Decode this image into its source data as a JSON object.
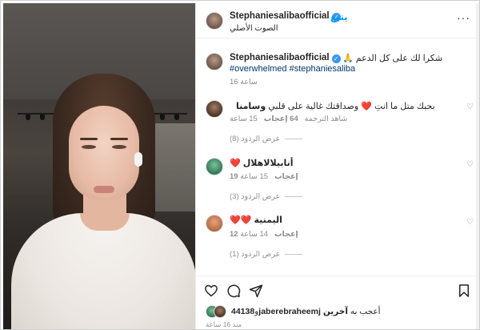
{
  "header": {
    "username": "Stephaniesaliba",
    "username_suffix": "official",
    "follow_label": "يتبع",
    "audio_label": "الصوت الأصلي"
  },
  "caption": {
    "username": "Stephaniesalibaofficial",
    "text": "🙏 شكرا لك على كل الدعم",
    "hashtags": "#overwhelmed #stephaniesaliba",
    "time": "16 ساعة"
  },
  "comments": [
    {
      "username": "وسامنا",
      "text": "بحبك متل ما انتِ ❤️ وصداقتك غالية على قلبي",
      "time": "15 ساعة",
      "likes": "64 إعجاب",
      "translate": "شاهد الترجمة",
      "replies": "عرض الردود (8)"
    },
    {
      "username": "أنابيلالاهلال",
      "text": "❤️",
      "time": "15 ساعة",
      "likes": "19 إعجاب",
      "replies": "عرض الردود (3)"
    },
    {
      "username": "اليمنية",
      "text": "❤️❤️",
      "time": "14 ساعة",
      "likes": "12 إعجاب",
      "replies": "عرض الردود (1)"
    }
  ],
  "likes_summary": {
    "prefix": "أعجب به",
    "user": "jaberebraheemj",
    "and": "و",
    "count": "44138",
    "others": "آخرين"
  },
  "time_ago": "منذ 16 ساعة",
  "icons": {
    "like": "heart-outline-icon",
    "comment": "speech-bubble-icon",
    "share": "paper-plane-icon",
    "save": "bookmark-icon",
    "verified": "verified-badge-icon",
    "more": "more-options-icon",
    "comment_like": "small-heart-icon"
  },
  "colors": {
    "accent": "#0095f6",
    "verified": "#3897f0",
    "heart": "#ed4956",
    "muted": "#8e8e8e",
    "hashtag": "#00376b"
  }
}
